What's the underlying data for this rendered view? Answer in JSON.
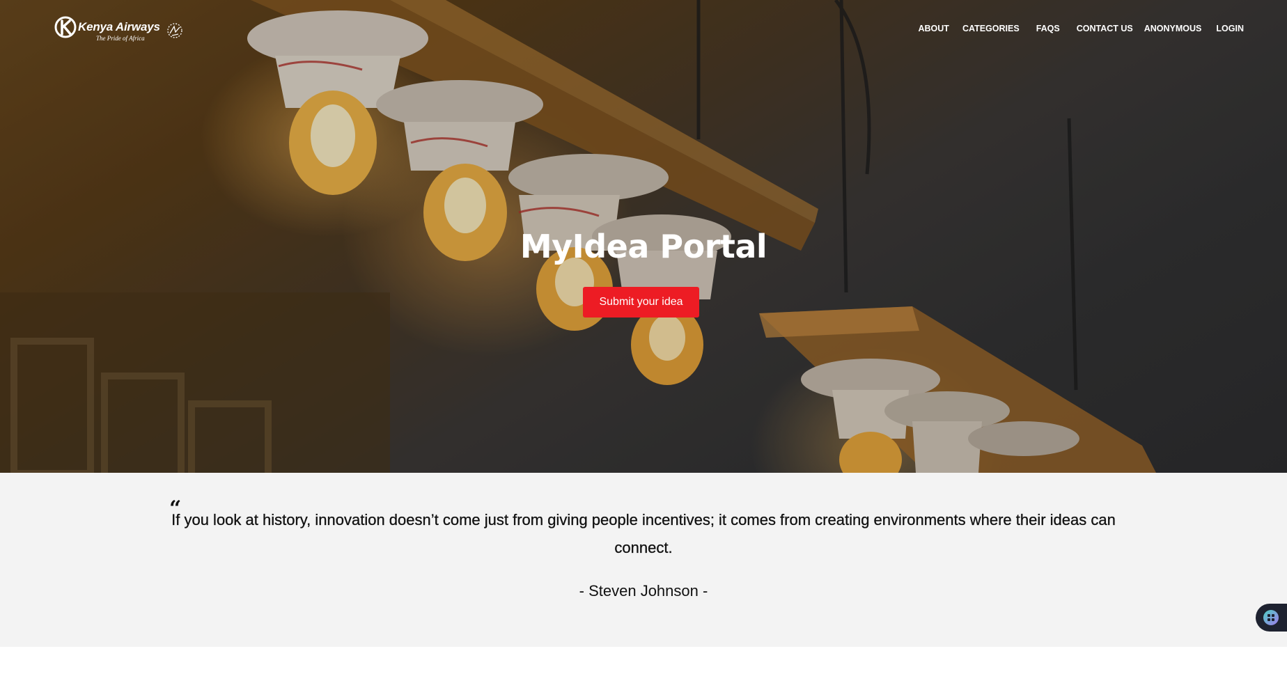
{
  "brand": {
    "name": "Kenya Airways",
    "tagline": "The Pride of Africa",
    "logo_icon": "kenya-airways-k-icon",
    "crane_icon": "crane-emblem-icon"
  },
  "nav": {
    "items": [
      {
        "label": "ABOUT"
      },
      {
        "label": "CATEGORIES"
      },
      {
        "label": "FAQS"
      },
      {
        "label": "CONTACT US"
      },
      {
        "label": "ANONYMOUS"
      },
      {
        "label": "LOGIN"
      }
    ]
  },
  "hero": {
    "title": "MyIdea Portal",
    "cta_label": "Submit your idea",
    "background_image": "hanging-light-bulbs"
  },
  "quote": {
    "mark": "“",
    "text": "If you look at history, innovation doesn’t come just from giving people incentives; it comes from creating environments where their ideas can connect.",
    "author": "- Steven Johnson -"
  },
  "widget": {
    "icon": "chat-widget-icon"
  },
  "colors": {
    "accent": "#ed1c24",
    "quote_background": "#f3f3f3",
    "widget_background": "#1e2230"
  }
}
